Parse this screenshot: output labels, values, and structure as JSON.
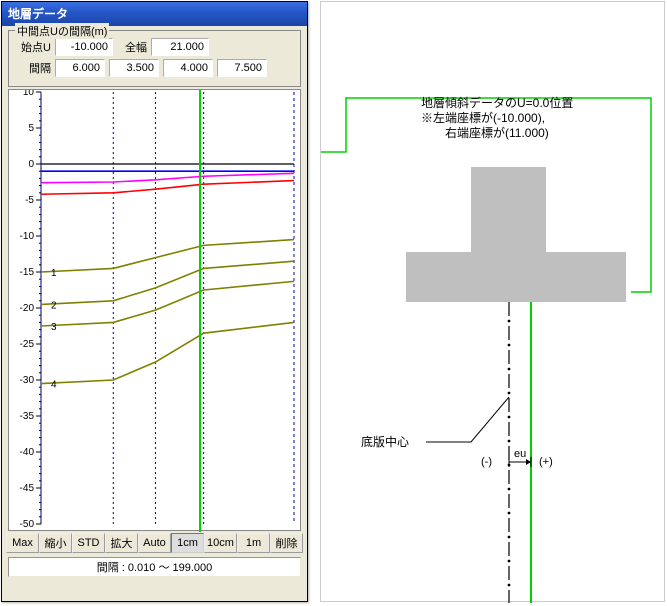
{
  "window": {
    "title": "地層データ"
  },
  "group": {
    "title": "中間点Uの間隔(m)",
    "start_u_label": "始点U",
    "start_u_value": "-10.000",
    "width_label": "全幅",
    "width_value": "21.000",
    "interval_label": "間隔",
    "intervals": [
      "6.000",
      "3.500",
      "4.000",
      "7.500"
    ]
  },
  "buttons": {
    "max": "Max",
    "shrink": "縮小",
    "std": "STD",
    "expand": "拡大",
    "auto": "Auto",
    "cm1": "1cm",
    "cm10": "10cm",
    "m1": "1m",
    "delete": "削除"
  },
  "status": "間隔 : 0.010 ～ 199.000",
  "annotations": {
    "line1": "地層傾斜データのU=0.0位置",
    "line2": "※左端座標が(-10.000),",
    "line3": "　右端座標が(11.000)",
    "bottom_center": "底版中心",
    "minus": "(-)",
    "plus": "(+)",
    "eu": "eu"
  },
  "chart_data": {
    "type": "line",
    "xlim": [
      -10,
      11
    ],
    "ylim": [
      -50,
      10
    ],
    "y_ticks": [
      10,
      5,
      0,
      -5,
      -10,
      -15,
      -20,
      -25,
      -30,
      -35,
      -40,
      -45,
      -50
    ],
    "grid_x": [
      -10,
      -4,
      -0.5,
      3.5,
      11
    ],
    "series": [
      {
        "name": "1-blue",
        "color": "#0000ff",
        "y": [
          -1.0,
          -1.0,
          -1.0,
          -1.0,
          -1.0
        ]
      },
      {
        "name": "2-magenta",
        "color": "#ff00ff",
        "y": [
          -2.6,
          -2.5,
          -2.2,
          -1.7,
          -1.3
        ]
      },
      {
        "name": "3-red",
        "color": "#ff0000",
        "y": [
          -4.2,
          -4.0,
          -3.5,
          -2.8,
          -2.3
        ]
      },
      {
        "name": "4-olive-a",
        "color": "#808000",
        "y": [
          -15.0,
          -14.5,
          -13.0,
          -11.3,
          -10.5
        ]
      },
      {
        "name": "5-olive-b",
        "color": "#808000",
        "y": [
          -19.5,
          -19.0,
          -17.2,
          -14.5,
          -13.5
        ]
      },
      {
        "name": "6-olive-c",
        "color": "#808000",
        "y": [
          -22.5,
          -22.0,
          -20.3,
          -17.5,
          -16.3
        ]
      },
      {
        "name": "7-olive-d",
        "color": "#808000",
        "y": [
          -30.5,
          -30.0,
          -27.5,
          -23.5,
          -22.0
        ]
      }
    ],
    "row_labels": [
      {
        "text": "1",
        "y": -15
      },
      {
        "text": "2",
        "y": -19.5
      },
      {
        "text": "3",
        "y": -22.5
      },
      {
        "text": "4",
        "y": -30.5
      }
    ],
    "green_line_x": 3.2
  }
}
